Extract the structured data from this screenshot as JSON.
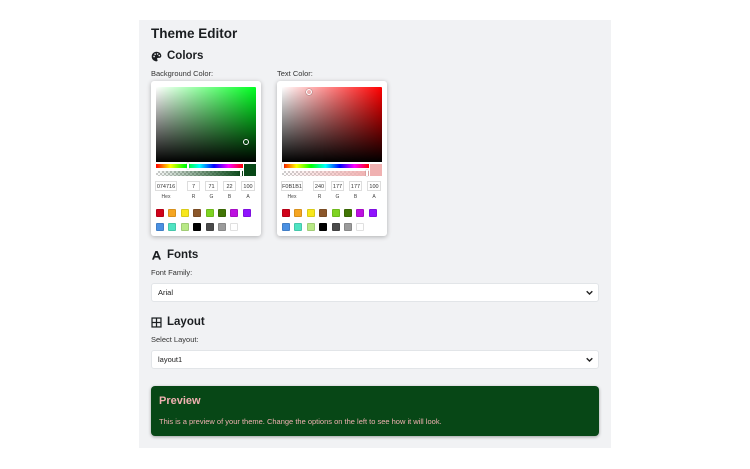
{
  "page": {
    "title": "Theme Editor"
  },
  "colors": {
    "heading": "Colors",
    "icon": "palette-icon",
    "background": {
      "label": "Background Color:",
      "hue_color": "#00ff21",
      "current": "#074716",
      "hex": "074716",
      "r": "7",
      "g": "71",
      "b": "22",
      "a": "100"
    },
    "text": {
      "label": "Text Color:",
      "hue_color": "#ff0000",
      "current": "#F0B1B1",
      "hex": "F0B1B1",
      "r": "240",
      "g": "177",
      "b": "177",
      "a": "100"
    },
    "field_labels": {
      "hex": "Hex",
      "r": "R",
      "g": "G",
      "b": "B",
      "a": "A"
    },
    "presets": [
      "#d0021b",
      "#f5a623",
      "#f8e71c",
      "#8b572a",
      "#7ed321",
      "#417505",
      "#bd10e0",
      "#9013fe",
      "#4a90e2",
      "#50e3c2",
      "#b8e986",
      "#000000",
      "#4a4a4a",
      "#9b9b9b",
      "#ffffff"
    ]
  },
  "fonts": {
    "heading": "Fonts",
    "icon": "font-icon",
    "label": "Font Family:",
    "selected": "Arial"
  },
  "layout": {
    "heading": "Layout",
    "icon": "grid-icon",
    "label": "Select Layout:",
    "selected": "layout1"
  },
  "preview": {
    "title": "Preview",
    "text": "This is a preview of your theme. Change the options on the left to see how it will look.",
    "bg_color": "#074716",
    "text_color": "#F0B1B1"
  }
}
